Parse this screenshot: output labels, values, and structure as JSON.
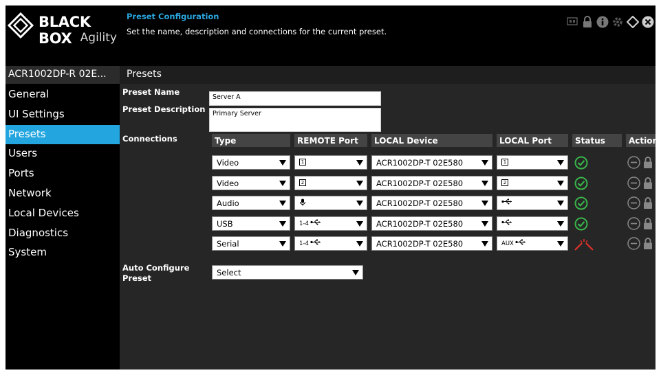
{
  "logo": {
    "brand": "BLACK BOX",
    "sub": "Agility"
  },
  "header": {
    "title": "Preset Configuration",
    "subtitle": "Set the name, description and connections for the current preset.",
    "icons": [
      "screen-icon",
      "lock-icon",
      "info-icon",
      "settings-icon",
      "refresh-icon",
      "close-icon"
    ]
  },
  "device": {
    "name": "ACR1002DP-R 02E..."
  },
  "page": {
    "title": "Presets"
  },
  "sidebar": {
    "items": [
      {
        "label": "General"
      },
      {
        "label": "UI Settings"
      },
      {
        "label": "Presets"
      },
      {
        "label": "Users"
      },
      {
        "label": "Ports"
      },
      {
        "label": "Network"
      },
      {
        "label": "Local Devices"
      },
      {
        "label": "Diagnostics"
      },
      {
        "label": "System"
      }
    ],
    "active_index": 2
  },
  "form": {
    "name_label": "Preset Name",
    "name_value": "Server A",
    "desc_label": "Preset Description",
    "desc_value": "Primary Server",
    "connections_label": "Connections",
    "auto_label_1": "Auto Configure",
    "auto_label_2": "Preset",
    "auto_value": "Select"
  },
  "table": {
    "headers": [
      "Type",
      "REMOTE Port",
      "LOCAL Device",
      "LOCAL Port",
      "Status",
      "Actions"
    ],
    "rows": [
      {
        "type": "Video",
        "remote": "1",
        "remote_icon": "monitor-1-icon",
        "device": "ACR1002DP-T 02E580",
        "local": "1",
        "local_icon": "monitor-1-icon",
        "status": "ok"
      },
      {
        "type": "Video",
        "remote": "2",
        "remote_icon": "monitor-2-icon",
        "device": "ACR1002DP-T 02E580",
        "local": "2",
        "local_icon": "monitor-2-icon",
        "status": "ok"
      },
      {
        "type": "Audio",
        "remote": "",
        "remote_icon": "microphone-icon",
        "device": "ACR1002DP-T 02E580",
        "local": "",
        "local_icon": "usb-icon",
        "status": "ok"
      },
      {
        "type": "USB",
        "remote": "1-4",
        "remote_icon": "usb-icon",
        "device": "ACR1002DP-T 02E580",
        "local": "",
        "local_icon": "usb-icon",
        "status": "ok"
      },
      {
        "type": "Serial",
        "remote": "1-4",
        "remote_icon": "usb-icon",
        "device": "ACR1002DP-T 02E580",
        "local": "AUX",
        "local_icon": "usb-icon",
        "status": "broken"
      }
    ]
  },
  "colors": {
    "accent": "#23a6e0",
    "ok": "#39b54a",
    "error": "#e0312b",
    "background": "#000000",
    "panel": "#262626"
  }
}
